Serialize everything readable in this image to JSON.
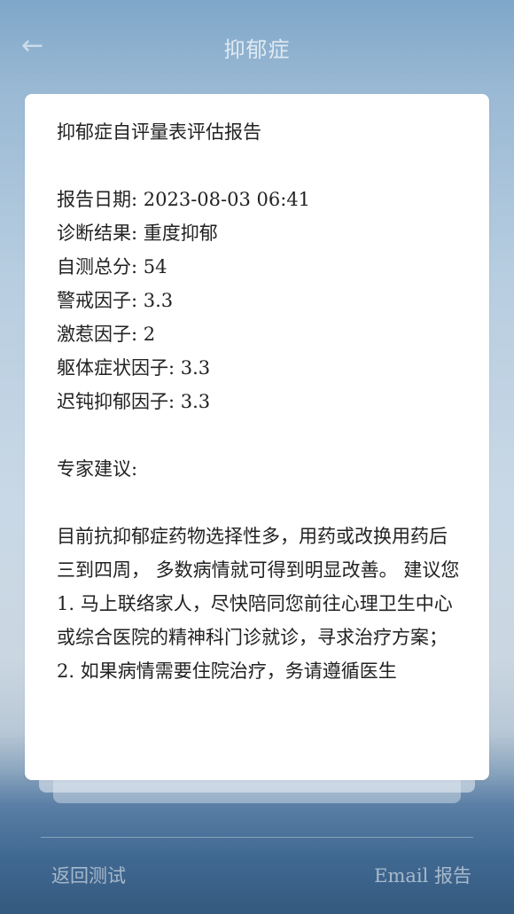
{
  "header": {
    "back_icon": "arrow-left-icon",
    "title": "抑郁症"
  },
  "report": {
    "title": "抑郁症自评量表评估报告",
    "date_label": "报告日期: ",
    "date_value": "2023-08-03 06:41",
    "diagnosis_label": "诊断结果: ",
    "diagnosis_value": "重度抑郁",
    "total_label": "自测总分: ",
    "total_value": "54",
    "factors": [
      {
        "label": "警戒因子: ",
        "value": "3.3"
      },
      {
        "label": "激惹因子: ",
        "value": "2"
      },
      {
        "label": "躯体症状因子: ",
        "value": "3.3"
      },
      {
        "label": "迟钝抑郁因子: ",
        "value": "3.3"
      }
    ],
    "advice_heading": "专家建议:",
    "advice_paragraph": "目前抗抑郁症药物选择性多，用药或改换用药后三到四周， 多数病情就可得到明显改善。 建议您",
    "advice_item_1": "1. 马上联络家人，尽快陪同您前往心理卫生中心或综合医院的精神科门诊就诊，寻求治疗方案；",
    "advice_item_2": "2. 如果病情需要住院治疗，务请遵循医生"
  },
  "footer": {
    "retest_label": "返回测试",
    "email_label": "Email 报告"
  }
}
